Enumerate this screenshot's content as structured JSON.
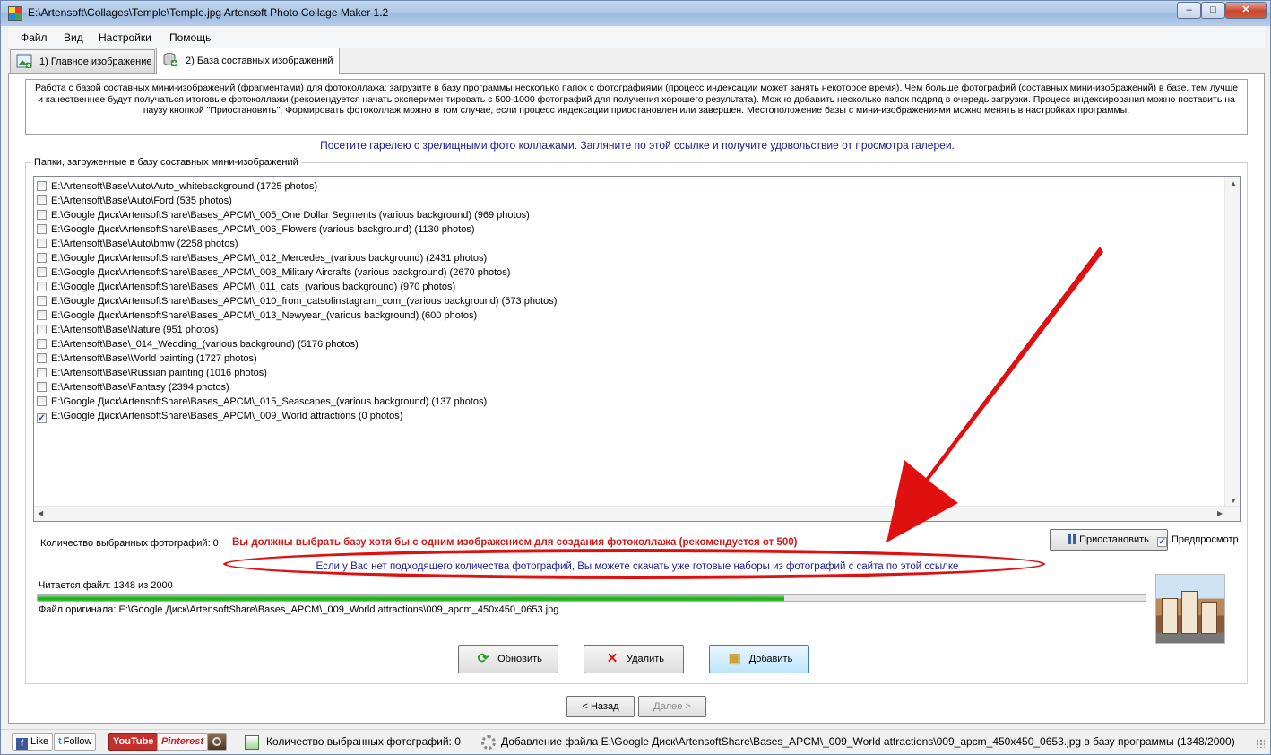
{
  "window": {
    "title": "E:\\Artensoft\\Collages\\Temple\\Temple.jpg Artensoft Photo Collage Maker 1.2",
    "min_glyph": "–",
    "max_glyph": "□",
    "close_glyph": "✕"
  },
  "menu": [
    "Файл",
    "Вид",
    "Настройки",
    "Помощь"
  ],
  "tabs": [
    {
      "label": "1) Главное изображение",
      "active": false
    },
    {
      "label": "2) База составных изображений",
      "active": true
    }
  ],
  "info_text": "Работа с базой составных мини-изображений (фрагментами) для фотоколлажа: загрузите в базу программы несколько папок с фотографиями (процесс индексации может занять некоторое время). Чем больше фотографий (составных мини-изображений) в базе, тем лучше и качественнее будут получаться итоговые фотоколлажи (рекомендуется начать экспериментировать с 500-1000 фотографий для получения хорошего результата). Можно добавить несколько папок подряд в очередь загрузки. Процесс индексирования можно поставить на паузу кнопкой \"Приостановить\". Формировать фотоколлаж можно в том случае, если процесс индексации приостановлен или завершен. Местоположение базы с мини-изображениями можно менять в настройках программы.",
  "gallery_link": "Посетите гарелею с зрелищными фото коллажами. Загляните по этой ссылке и получите удовольствие от просмотра галереи.",
  "folders_group_title": "Папки, загруженные в базу составных мини-изображений",
  "folders": [
    {
      "path": "E:\\Artensoft\\Base\\Auto\\Auto_whitebackground (1725 photos)",
      "checked": false
    },
    {
      "path": "E:\\Artensoft\\Base\\Auto\\Ford (535 photos)",
      "checked": false
    },
    {
      "path": "E:\\Google Диск\\ArtensoftShare\\Bases_APCM\\_005_One Dollar Segments (various background) (969 photos)",
      "checked": false
    },
    {
      "path": "E:\\Google Диск\\ArtensoftShare\\Bases_APCM\\_006_Flowers (various background) (1130 photos)",
      "checked": false
    },
    {
      "path": "E:\\Artensoft\\Base\\Auto\\bmw (2258 photos)",
      "checked": false
    },
    {
      "path": "E:\\Google Диск\\ArtensoftShare\\Bases_APCM\\_012_Mercedes_(various background) (2431 photos)",
      "checked": false
    },
    {
      "path": "E:\\Google Диск\\ArtensoftShare\\Bases_APCM\\_008_Military Aircrafts (various background) (2670 photos)",
      "checked": false
    },
    {
      "path": "E:\\Google Диск\\ArtensoftShare\\Bases_APCM\\_011_cats_(various background) (970 photos)",
      "checked": false
    },
    {
      "path": "E:\\Google Диск\\ArtensoftShare\\Bases_APCM\\_010_from_catsofinstagram_com_(various background) (573 photos)",
      "checked": false
    },
    {
      "path": "E:\\Google Диск\\ArtensoftShare\\Bases_APCM\\_013_Newyear_(various background) (600 photos)",
      "checked": false
    },
    {
      "path": "E:\\Artensoft\\Base\\Nature (951 photos)",
      "checked": false
    },
    {
      "path": "E:\\Artensoft\\Base\\_014_Wedding_(various background) (5176 photos)",
      "checked": false
    },
    {
      "path": "E:\\Artensoft\\Base\\World painting (1727 photos)",
      "checked": false
    },
    {
      "path": "E:\\Artensoft\\Base\\Russian painting (1016 photos)",
      "checked": false
    },
    {
      "path": "E:\\Artensoft\\Base\\Fantasy (2394 photos)",
      "checked": false
    },
    {
      "path": "E:\\Google Диск\\ArtensoftShare\\Bases_APCM\\_015_Seascapes_(various background) (137 photos)",
      "checked": false
    },
    {
      "path": "E:\\Google Диск\\ArtensoftShare\\Bases_APCM\\_009_World attractions (0 photos)",
      "checked": true
    }
  ],
  "selected_count_label": "Количество выбранных фотографий: 0",
  "warning": "Вы должны выбрать базу хотя бы с одним изображением для создания фотоколлажа (рекомендуется от 500)",
  "pause_button": "Приостановить",
  "preview_label": "Предпросмотр",
  "preview_checked": true,
  "download_link": "Если у Вас нет подходящего количества фотографий, Вы можете скачать уже готовые наборы из фотографий с сайта по этой ссылке",
  "reading_label": "Читается файл: 1348  из  2000",
  "progress": {
    "current": 1348,
    "total": 2000
  },
  "original_file": "Файл оригинала:  E:\\Google Диск\\ArtensoftShare\\Bases_APCM\\_009_World attractions\\009_apcm_450x450_0653.jpg",
  "buttons": {
    "refresh": "Обновить",
    "delete": "Удалить",
    "add": "Добавить",
    "back": "< Назад",
    "next": "Далее >"
  },
  "statusbar": {
    "like": "Like",
    "follow": "Follow",
    "youtube": "YouTube",
    "pinterest": "Pinterest",
    "count": "Количество выбранных фотографий: 0",
    "status": "Добавление файла E:\\Google Диск\\ArtensoftShare\\Bases_APCM\\_009_World attractions\\009_apcm_450x450_0653.jpg в базу программы (1348/2000)"
  },
  "colors": {
    "accent_red": "#e01010",
    "link": "#1a1a9a",
    "warning": "#d01818",
    "progress": "#1ea51e"
  }
}
